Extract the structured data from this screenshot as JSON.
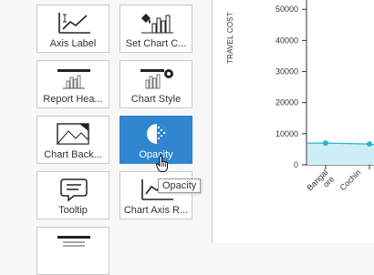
{
  "panel": {
    "tiles": [
      {
        "label": "Axis Label",
        "icon": "axis-label-icon"
      },
      {
        "label": "Set Chart C...",
        "icon": "set-chart-color-icon"
      },
      {
        "label": "Report Hea...",
        "icon": "report-header-icon"
      },
      {
        "label": "Chart Style",
        "icon": "chart-style-icon"
      },
      {
        "label": "Chart Back...",
        "icon": "chart-background-icon"
      },
      {
        "label": "Opacity",
        "icon": "opacity-icon",
        "active": true
      },
      {
        "label": "Tooltip",
        "icon": "tooltip-icon"
      },
      {
        "label": "Chart Axis R...",
        "icon": "chart-axis-range-icon"
      },
      {
        "label": "",
        "icon": "report-footer-icon"
      }
    ],
    "active_color": "#2f86cf"
  },
  "tooltip": {
    "text": "Opacity"
  },
  "chart_data": {
    "type": "area",
    "ylabel": "TRAVEL COST",
    "categories": [
      "Bangal ore",
      "Cochin"
    ],
    "values": [
      7000,
      6700
    ],
    "yticks": [
      0,
      10000,
      20000,
      30000,
      40000,
      50000
    ],
    "ylim": [
      0,
      53000
    ],
    "fill_color": "#cdeef6",
    "line_color": "#27b3d6"
  }
}
